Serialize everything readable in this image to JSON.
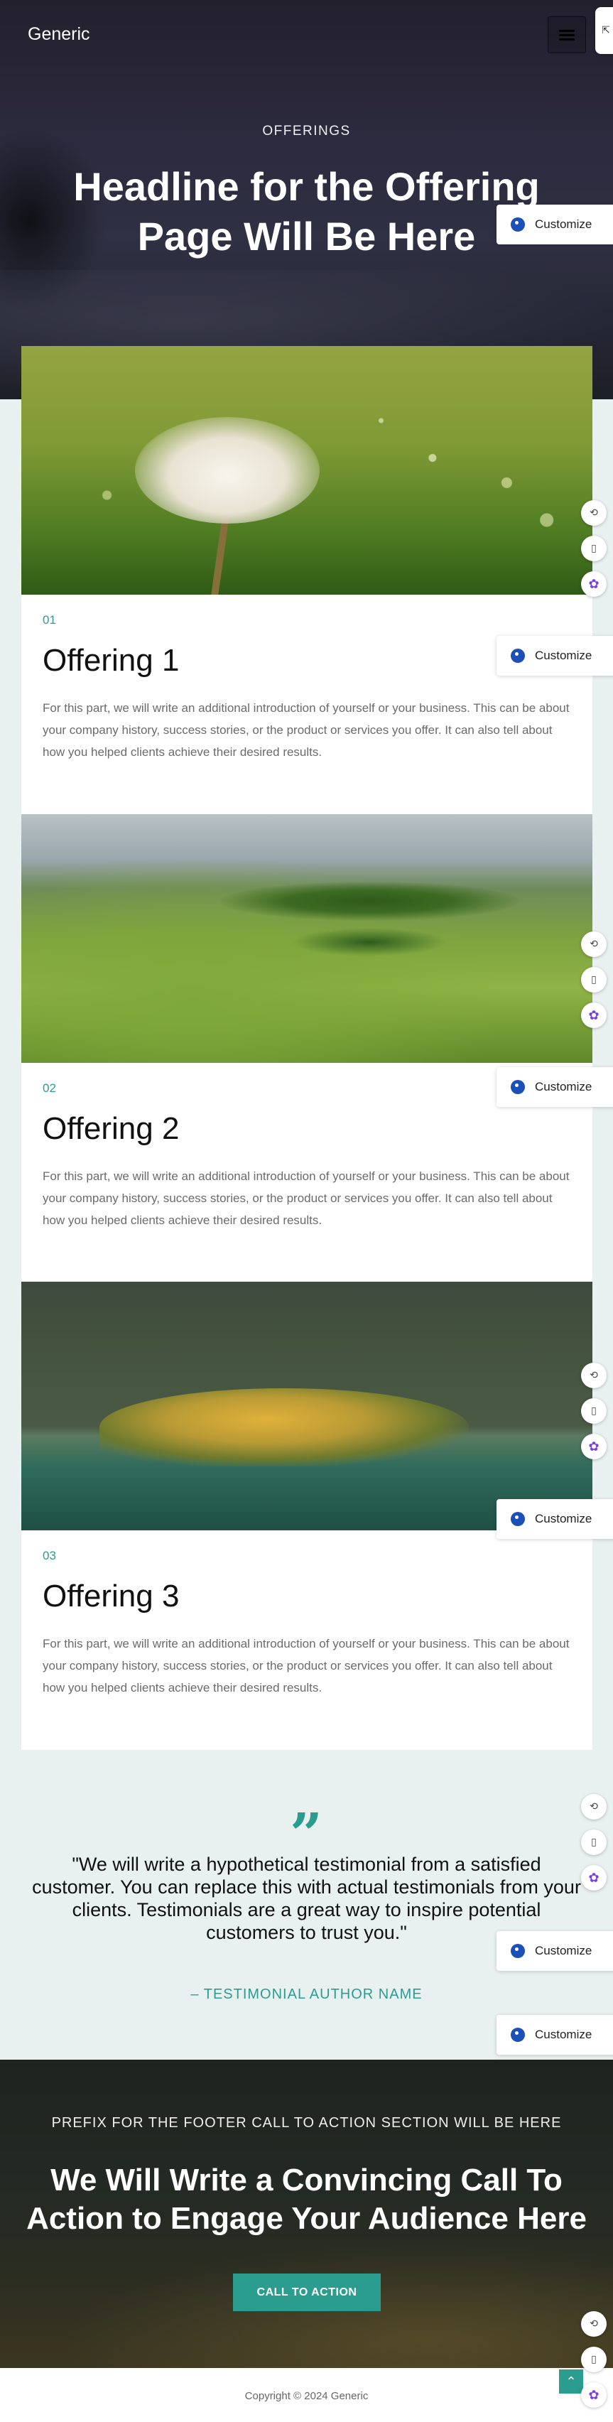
{
  "header": {
    "brand": "Generic",
    "menu_icon": "hamburger-icon"
  },
  "hero": {
    "eyebrow": "OFFERINGS",
    "title": "Headline for the Offering Page Will Be Here"
  },
  "offerings": [
    {
      "number": "01",
      "title": "Offering 1",
      "text": "For this part, we will write an additional introduction of yourself or your business. This can be about your company history, success stories, or the product or services you offer. It can also tell about how you helped clients achieve their desired results."
    },
    {
      "number": "02",
      "title": "Offering 2",
      "text": "For this part, we will write an additional introduction of yourself or your business. This can be about your company history, success stories, or the product or services you offer. It can also tell about how you helped clients achieve their desired results."
    },
    {
      "number": "03",
      "title": "Offering 3",
      "text": "For this part, we will write an additional introduction of yourself or your business. This can be about your company history, success stories, or the product or services you offer. It can also tell about how you helped clients achieve their desired results."
    }
  ],
  "testimonial": {
    "quote_glyph": "”",
    "text": "\"We will write a hypothetical testimonial from a satisfied customer. You can replace this with actual testimonials from your clients. Testimonials are a great way to inspire potential customers to trust you.\"",
    "author": "– TESTIMONIAL AUTHOR NAME"
  },
  "cta": {
    "prefix": "PREFIX FOR THE FOOTER CALL TO ACTION SECTION WILL BE HERE",
    "title": "We Will Write a Convincing Call To Action to Engage Your Audience Here",
    "button_label": "CALL TO ACTION"
  },
  "footer": {
    "copyright": "Copyright © 2024 Generic"
  },
  "tools": {
    "customize_label": "Customize",
    "icons": [
      "palette-icon",
      "sync-icon",
      "book-icon",
      "brain-icon",
      "arrow-up-icon"
    ]
  },
  "colors": {
    "accent": "#2a9d8f",
    "background": "#e9f1f0",
    "customize_icon": "#1d4fb8"
  }
}
